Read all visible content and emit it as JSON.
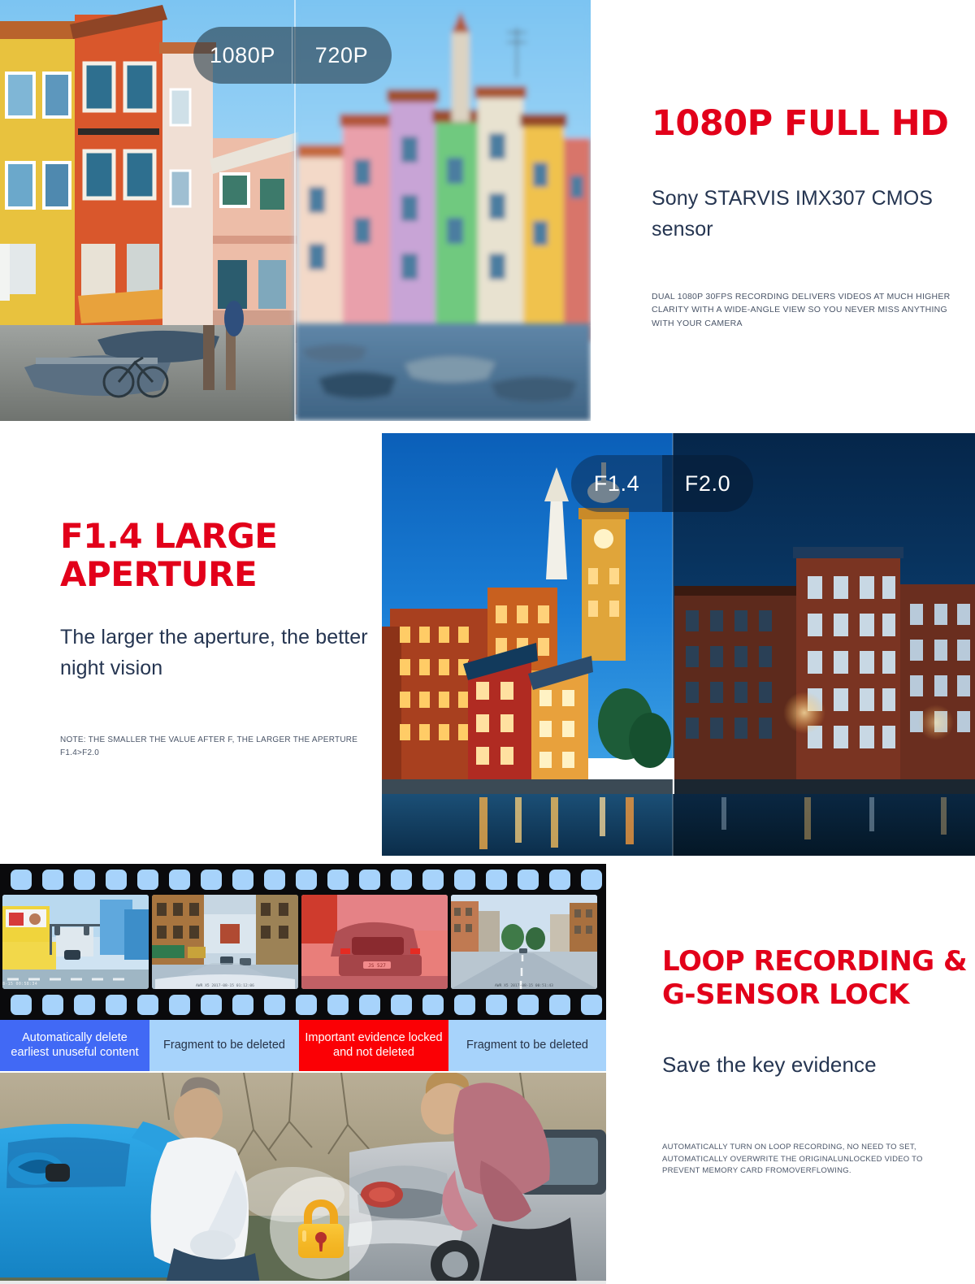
{
  "sections": [
    {
      "id": "full-hd",
      "headline": "1080P FULL HD",
      "subhead": "Sony STARVIS IMX307 CMOS sensor",
      "fineprint": "DUAL 1080P 30FPS RECORDING DELIVERS VIDEOS AT MUCH HIGHER CLARITY WITH A WIDE-ANGLE VIEW SO YOU NEVER MISS ANYTHING WITH YOUR CAMERA",
      "badge": {
        "left_label": "1080P",
        "right_label": "720P"
      },
      "image_alt": "Colourful canal houses in Burano, left half sharp, right half blurred"
    },
    {
      "id": "large-aperture",
      "headline": "F1.4 LARGE APERTURE",
      "subhead": "The larger the aperture, the better night vision",
      "fineprint": "NOTE: THE SMALLER THE VALUE AFTER F, THE LARGER THE APERTURE F1.4>F2.0",
      "badge": {
        "left_label": "F1.4",
        "right_label": "F2.0"
      },
      "image_alt": "Waterfront city at dusk, left half bright, right half dark"
    },
    {
      "id": "loop-recording",
      "headline_line1": "LOOP RECORDING &",
      "headline_line2": "G-SENSOR  LOCK",
      "subhead": "Save the key evidence",
      "fineprint": "AUTOMATICALLY TURN ON LOOP RECORDING, NO NEED TO SET, AUTOMATICALLY OVERWRITE THE ORIGINALUNLOCKED VIDEO TO PREVENT MEMORY CARD FROMOVERFLOWING.",
      "image_alt": "Two men inspecting rear-end collision damage between blue and silver cars"
    }
  ],
  "filmstrip": {
    "frames": [
      {
        "timestamp": "AWR X5   2017-08-15 00:58:34",
        "alt": "city intersection with billboards"
      },
      {
        "timestamp": "AWR X5   2017-08-15 01:12:06",
        "alt": "narrow street between buildings"
      },
      {
        "timestamp": "",
        "alt": "close following car, red alert overlay"
      },
      {
        "timestamp": "AWR X5   2017-08-15 00:51:43",
        "alt": "open road through town"
      }
    ],
    "captions": [
      {
        "text": "Automatically delete earliest unuseful content",
        "bg": "#4169f5",
        "color": "#ffffff"
      },
      {
        "text": "Fragment to be deleted",
        "bg": "#a7d3fb",
        "color": "#263246"
      },
      {
        "text": "Important evidence locked and not deleted",
        "bg": "#fb0005",
        "color": "#ffffff"
      },
      {
        "text": "Fragment to be deleted",
        "bg": "#a7d3fb",
        "color": "#263246"
      }
    ]
  },
  "icons": {
    "lock": "padlock-icon"
  },
  "colors": {
    "accent_red": "#e2001a",
    "body_navy": "#253551",
    "caption_blue": "#4169f5",
    "caption_lightblue": "#a7d3fb",
    "caption_red": "#fb0005",
    "lock_gold": "#f6b61c",
    "page_bg": "#ffffff"
  }
}
